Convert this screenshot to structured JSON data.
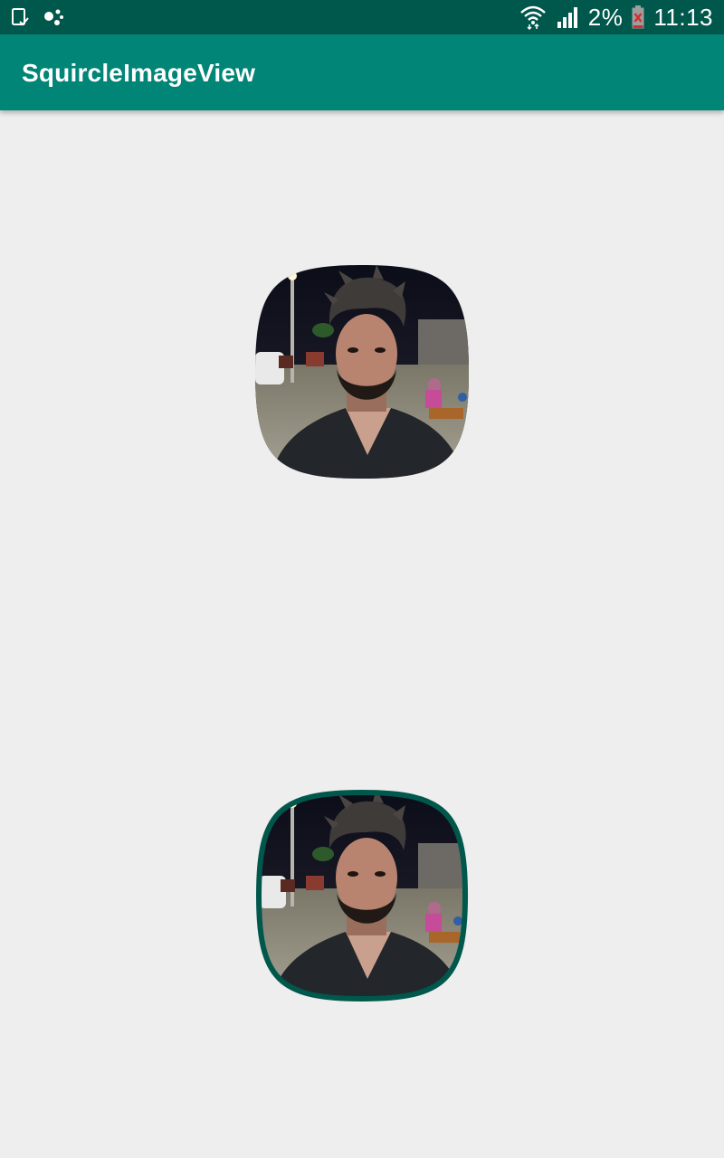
{
  "status_bar": {
    "battery_percent": "2%",
    "time": "11:13",
    "icons": [
      "sim-notification-icon",
      "assistant-dots-icon",
      "wifi-icon",
      "signal-icon",
      "battery-low-icon"
    ]
  },
  "app_bar": {
    "title": "SquircleImageView"
  },
  "images": [
    {
      "name": "squircle-image-plain",
      "border": false
    },
    {
      "name": "squircle-image-bordered",
      "border": true,
      "border_color": "#00574b"
    }
  ],
  "colors": {
    "status_bar": "#00574b",
    "app_bar": "#008577",
    "background": "#eeeeee",
    "accent_border": "#00574b"
  }
}
